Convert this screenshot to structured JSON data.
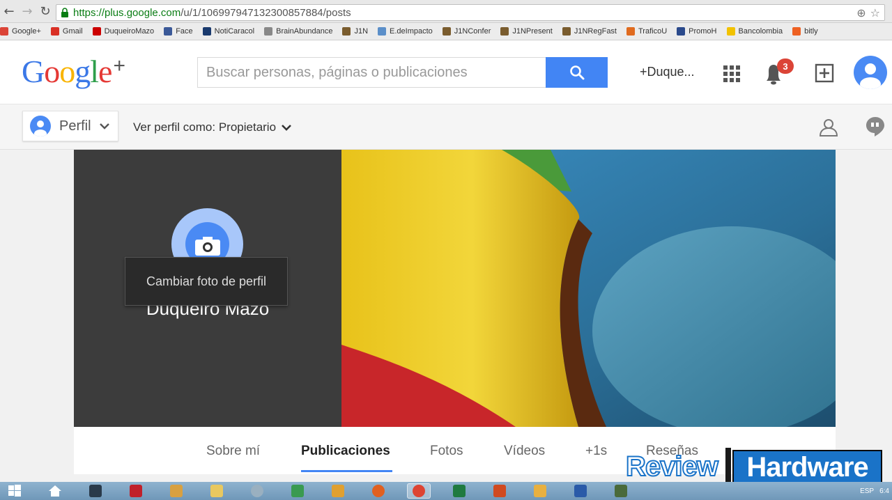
{
  "browser": {
    "url_host": "https://plus.google.com",
    "url_path": "/u/1/106997947132300857884/posts"
  },
  "bookmarks": [
    {
      "label": "Google+",
      "color": "#db4437"
    },
    {
      "label": "Gmail",
      "color": "#d93025"
    },
    {
      "label": "DuqueiroMazo",
      "color": "#cc0000"
    },
    {
      "label": "Face",
      "color": "#3b5998"
    },
    {
      "label": "NotiCaracol",
      "color": "#1a3a6e"
    },
    {
      "label": "BrainAbundance",
      "color": "#888888"
    },
    {
      "label": "J1N",
      "color": "#7a5c2e"
    },
    {
      "label": "E.deImpacto",
      "color": "#5b8fc9"
    },
    {
      "label": "J1NConfer",
      "color": "#7a5c2e"
    },
    {
      "label": "J1NPresent",
      "color": "#7a5c2e"
    },
    {
      "label": "J1NRegFast",
      "color": "#7a5c2e"
    },
    {
      "label": "TraficoU",
      "color": "#e06b1f"
    },
    {
      "label": "PromoH",
      "color": "#2b4a8c"
    },
    {
      "label": "Bancolombia",
      "color": "#f2c200"
    },
    {
      "label": "bitly",
      "color": "#ee6123"
    }
  ],
  "header": {
    "logo_text": "Google",
    "logo_plus": "+",
    "search_placeholder": "Buscar personas, páginas o publicaciones",
    "user_name": "+Duque...",
    "notification_count": "3"
  },
  "subbar": {
    "profile_button": "Perfil",
    "view_as": "Ver perfil como: Propietario"
  },
  "profile": {
    "name": "Duqueiro Mazo",
    "tooltip": "Cambiar foto de perfil"
  },
  "tabs": [
    {
      "label": "Sobre mí"
    },
    {
      "label": "Publicaciones"
    },
    {
      "label": "Fotos"
    },
    {
      "label": "Vídeos"
    },
    {
      "label": "+1s"
    },
    {
      "label": "Reseñas"
    }
  ],
  "watermark": {
    "part1": "Review",
    "part2": "Hardware"
  },
  "tray": {
    "lang": "ESP",
    "time": "6:4"
  },
  "colors": {
    "accent_blue": "#4285f4",
    "notification_red": "#db4437"
  }
}
